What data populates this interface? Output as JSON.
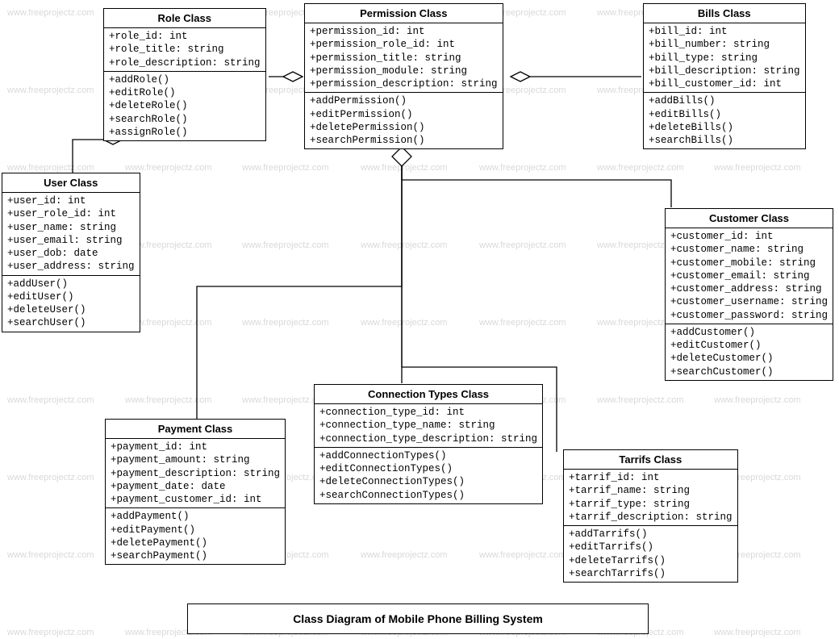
{
  "caption": "Class Diagram of Mobile Phone Billing System",
  "watermark": "www.freeprojectz.com",
  "classes": {
    "role": {
      "title": "Role Class",
      "attrs": [
        "+role_id: int",
        "+role_title: string",
        "+role_description: string"
      ],
      "ops": [
        "+addRole()",
        "+editRole()",
        "+deleteRole()",
        "+searchRole()",
        "+assignRole()"
      ]
    },
    "permission": {
      "title": "Permission Class",
      "attrs": [
        "+permission_id: int",
        "+permission_role_id: int",
        "+permission_title: string",
        "+permission_module: string",
        "+permission_description: string"
      ],
      "ops": [
        "+addPermission()",
        "+editPermission()",
        "+deletePermission()",
        "+searchPermission()"
      ]
    },
    "bills": {
      "title": "Bills Class",
      "attrs": [
        "+bill_id: int",
        "+bill_number: string",
        "+bill_type: string",
        "+bill_description: string",
        "+bill_customer_id: int"
      ],
      "ops": [
        "+addBills()",
        "+editBills()",
        "+deleteBills()",
        "+searchBills()"
      ]
    },
    "user": {
      "title": "User Class",
      "attrs": [
        "+user_id: int",
        "+user_role_id: int",
        "+user_name: string",
        "+user_email: string",
        "+user_dob: date",
        "+user_address: string"
      ],
      "ops": [
        "+addUser()",
        "+editUser()",
        "+deleteUser()",
        "+searchUser()"
      ]
    },
    "customer": {
      "title": "Customer Class",
      "attrs": [
        "+customer_id: int",
        "+customer_name: string",
        "+customer_mobile: string",
        "+customer_email: string",
        "+customer_address: string",
        "+customer_username: string",
        "+customer_password: string"
      ],
      "ops": [
        "+addCustomer()",
        "+editCustomer()",
        "+searchCustomer()"
      ]
    },
    "customer_ops_extra": [
      "+deleteCustomer()"
    ],
    "payment": {
      "title": "Payment Class",
      "attrs": [
        "+payment_id: int",
        "+payment_amount: string",
        "+payment_description: string",
        "+payment_date: date",
        "+payment_customer_id: int"
      ],
      "ops": [
        "+addPayment()",
        "+editPayment()",
        "+deletePayment()",
        "+searchPayment()"
      ]
    },
    "conntypes": {
      "title": "Connection Types  Class",
      "attrs": [
        "+connection_type_id: int",
        "+connection_type_name: string",
        "+connection_type_description: string"
      ],
      "ops": [
        "+addConnectionTypes()",
        "+editConnectionTypes()",
        "+deleteConnectionTypes()",
        "+searchConnectionTypes()"
      ]
    },
    "tarrifs": {
      "title": "Tarrifs Class",
      "attrs": [
        "+tarrif_id: int",
        "+tarrif_name: string",
        "+tarrif_type: string",
        "+tarrif_description: string"
      ],
      "ops": [
        "+addTarrifs()",
        "+editTarrifs()",
        "+deleteTarrifs()",
        "+searchTarrifs()"
      ]
    }
  }
}
